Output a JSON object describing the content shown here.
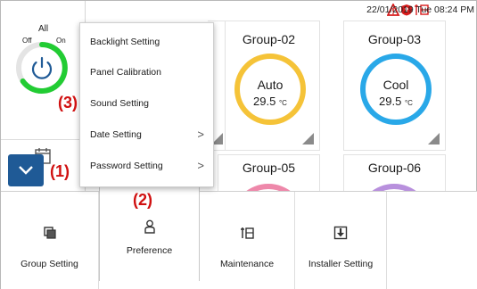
{
  "app": {
    "status_bar": {
      "datetime": "22/01/2019 Tue 08:24 PM",
      "icons": [
        "alert-triangle-icon",
        "shield-icon",
        "maintenance-icon"
      ]
    },
    "left_panel": {
      "all_label": "All",
      "off_label": "Off",
      "on_label": "On",
      "power_icon": "power-icon",
      "schedule_icon": "calendar-icon",
      "expand_icon": "chevron-down-icon"
    }
  },
  "groups": [
    {
      "name": "Group-02",
      "mode": "Auto",
      "temp": "29.5",
      "unit": "°C",
      "ring_color": "#f5c338"
    },
    {
      "name": "Group-03",
      "mode": "Cool",
      "temp": "29.5",
      "unit": "°C",
      "ring_color": "#29a8e8"
    },
    {
      "name": "Group-05",
      "ring_color": "#ee88aa"
    },
    {
      "name": "Group-06",
      "ring_color": "#b890dd"
    }
  ],
  "menu": {
    "items": [
      {
        "label": "Backlight Setting",
        "submenu": false
      },
      {
        "label": "Panel Calibration",
        "submenu": false
      },
      {
        "label": "Sound Setting",
        "submenu": false
      },
      {
        "label": "Date Setting",
        "submenu": true,
        "chevron": ">"
      },
      {
        "label": "Password Setting",
        "submenu": true,
        "chevron": ">"
      }
    ]
  },
  "nav": {
    "tabs": [
      {
        "label": "Group Setting",
        "icon": "group-icon",
        "active": false
      },
      {
        "label": "Preference",
        "icon": "user-icon",
        "active": true
      },
      {
        "label": "Maintenance",
        "icon": "maintenance-icon",
        "active": false
      },
      {
        "label": "Installer Setting",
        "icon": "download-box-icon",
        "active": false
      }
    ]
  },
  "annotations": [
    "(1)",
    "(2)",
    "(3)"
  ],
  "colors": {
    "accent_blue": "#1f5a96",
    "power_ring_green": "#22cc33",
    "annotation_red": "#d01010",
    "alert_red": "#d81b1b"
  }
}
